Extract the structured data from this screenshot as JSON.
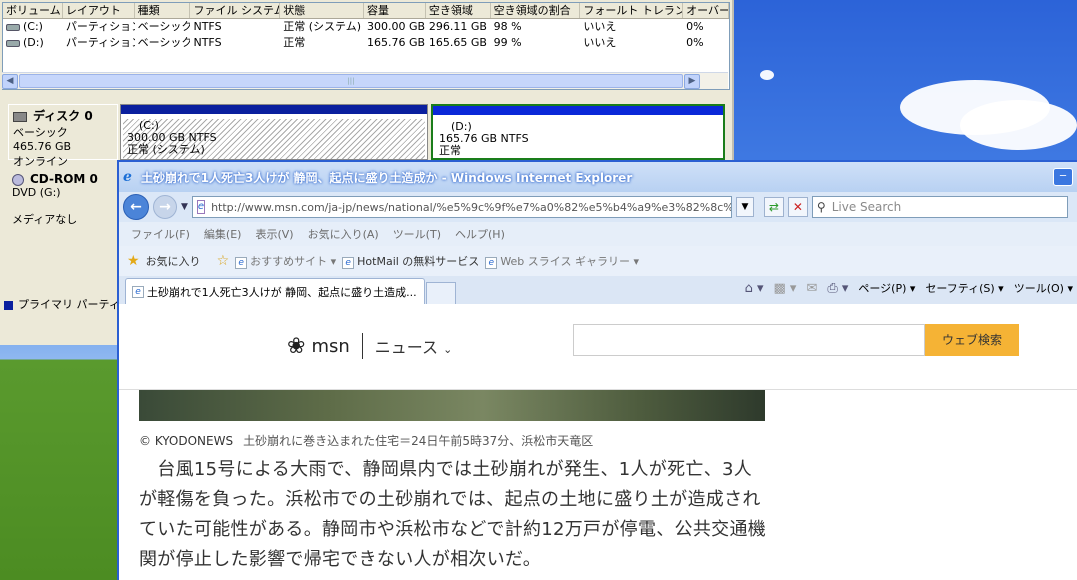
{
  "disk_mgmt": {
    "columns": [
      "ボリューム",
      "レイアウト",
      "種類",
      "ファイル システム",
      "状態",
      "容量",
      "空き領域",
      "空き領域の割合",
      "フォールト トレランス",
      "オーバー"
    ],
    "rows": [
      [
        "(C:)",
        "パーティション",
        "ベーシック",
        "NTFS",
        "正常 (システム)",
        "300.00 GB",
        "296.11 GB",
        "98 %",
        "いいえ",
        "0%"
      ],
      [
        "(D:)",
        "パーティション",
        "ベーシック",
        "NTFS",
        "正常",
        "165.76 GB",
        "165.65 GB",
        "99 %",
        "いいえ",
        "0%"
      ]
    ],
    "disk0": {
      "title": "ディスク 0",
      "type": "ベーシック",
      "size": "465.76 GB",
      "status": "オンライン"
    },
    "cdrom": {
      "title": "CD-ROM 0",
      "drive": "DVD (G:)",
      "media": "メディアなし"
    },
    "part_c": {
      "name": "(C:)",
      "size": "300.00 GB NTFS",
      "status": "正常 (システム)"
    },
    "part_d": {
      "name": "(D:)",
      "size": "165.76 GB NTFS",
      "status": "正常"
    },
    "legend": "プライマリ パーティション"
  },
  "ie": {
    "title": "土砂崩れで1人死亡3人けが 静岡、起点に盛り土造成か - Windows Internet Explorer",
    "url": "http://www.msn.com/ja-jp/news/national/%e5%9c%9f%e7%a0%82%e5%b4%a9%e3%82%8c%e3%81%a71%e4",
    "search_placeholder": "Live Search",
    "menu": [
      "ファイル(F)",
      "編集(E)",
      "表示(V)",
      "お気に入り(A)",
      "ツール(T)",
      "ヘルプ(H)"
    ],
    "favorites_label": "お気に入り",
    "fav_links": [
      "おすすめサイト",
      "HotMail の無料サービス",
      "Web スライス ギャラリー"
    ],
    "tab_title": "土砂崩れで1人死亡3人けが 静岡、起点に盛り土造成...",
    "cmd_page": "ページ(P)",
    "cmd_safety": "セーフティ(S)",
    "cmd_tools": "ツール(O)"
  },
  "msn": {
    "logo": "msn",
    "section": "ニュース",
    "search_button": "ウェブ検索",
    "credit": "© KYODONEWS",
    "caption": "土砂崩れに巻き込まれた住宅＝24日午前5時37分、浜松市天竜区",
    "body": "台風15号による大雨で、静岡県内では土砂崩れが発生、1人が死亡、3人が軽傷を負った。浜松市での土砂崩れでは、起点の土地に盛り土が造成されていた可能性がある。静岡市や浜松市などで計約12万戸が停電、公共交通機関が停止した影響で帰宅できない人が相次いだ。"
  }
}
